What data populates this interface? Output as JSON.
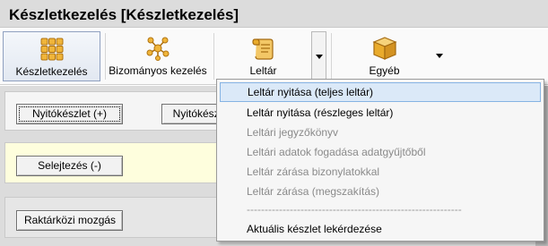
{
  "window": {
    "title": "Készletkezelés [Készletkezelés]"
  },
  "ribbon": {
    "buttons": [
      {
        "label": "Készletkezelés",
        "icon": "grid-icon"
      },
      {
        "label": "Bizományos kezelés",
        "icon": "network-icon"
      },
      {
        "label": "Leltár",
        "icon": "scroll-icon"
      },
      {
        "label": "Egyéb",
        "icon": "box-icon"
      }
    ]
  },
  "panels": {
    "opening": {
      "btn1": "Nyitókészlet (+)",
      "btn2": "Nyitókészlet"
    },
    "scrap": {
      "btn": "Selejtezés (-)"
    },
    "transfer": {
      "btn": "Raktárközi mozgás"
    }
  },
  "menu": {
    "items": [
      {
        "label": "Leltár nyitása (teljes leltár)"
      },
      {
        "label": "Leltár nyitása (részleges leltár)"
      },
      {
        "label": "Leltári jegyzőkönyv"
      },
      {
        "label": "Leltári adatok fogadása adatgyűjtőből"
      },
      {
        "label": "Leltár zárása bizonylatokkal"
      },
      {
        "label": "Leltár zárása (megszakítás)"
      },
      {
        "label": "------------------------------------------------------------"
      },
      {
        "label": "Aktuális készlet lekérdezése"
      }
    ]
  },
  "colors": {
    "accent_gold": "#e8a318",
    "highlight": "#dbe9f8",
    "yellow_panel": "#fefedd"
  }
}
